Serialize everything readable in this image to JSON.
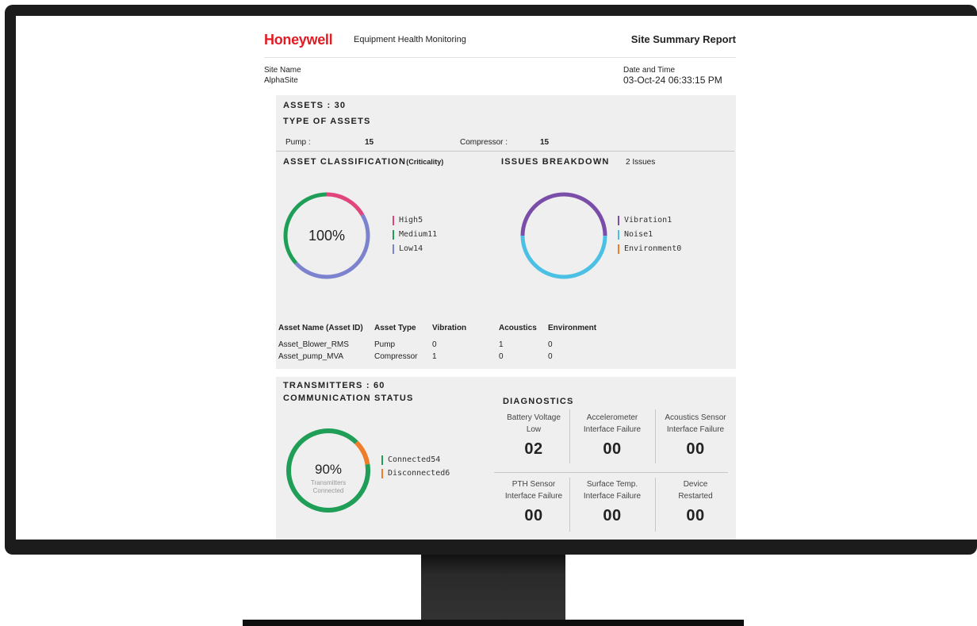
{
  "header": {
    "logo": "Honeywell",
    "app_title": "Equipment Health Monitoring",
    "report_title": "Site Summary Report"
  },
  "site": {
    "name_label": "Site Name",
    "name": "AlphaSite",
    "date_label": "Date and Time",
    "date": "03-Oct-24 06:33:15 PM"
  },
  "assets": {
    "title": "ASSETS : 30",
    "types_title": "TYPE OF ASSETS",
    "types": [
      {
        "label": "Pump :",
        "count": "15"
      },
      {
        "label": "Compressor :",
        "count": "15"
      }
    ],
    "classification_title": "ASSET CLASSIFICATION",
    "classification_sub": "(Criticality)",
    "classification_center": "100%",
    "classification": [
      {
        "name": "High",
        "value": "5",
        "count": 5,
        "color": "#e0457b"
      },
      {
        "name": "Medium",
        "value": "11",
        "count": 11,
        "color": "#1f9e57"
      },
      {
        "name": "Low",
        "value": "14",
        "count": 14,
        "color": "#7b83cf"
      }
    ],
    "issues_title": "ISSUES BREAKDOWN",
    "issues_count": "2 Issues",
    "issues": [
      {
        "name": "Vibration",
        "value": "1",
        "count": 1,
        "color": "#7a4ea8"
      },
      {
        "name": "Noise",
        "value": "1",
        "count": 1,
        "color": "#4bc0e5"
      },
      {
        "name": "Environment",
        "value": "0",
        "count": 0,
        "color": "#ee7d2b"
      }
    ],
    "table": {
      "headers": [
        "Asset Name (Asset ID)",
        "Asset Type",
        "Vibration",
        "Acoustics",
        "Environment"
      ],
      "rows": [
        [
          "Asset_Blower_RMS",
          "Pump",
          "0",
          "1",
          "0"
        ],
        [
          "Asset_pump_MVA",
          "Compressor",
          "1",
          "0",
          "0"
        ]
      ]
    }
  },
  "transmitters": {
    "title": "TRANSMITTERS : 60",
    "comm_title": "COMMUNICATION STATUS",
    "center_value": "90%",
    "center_label_1": "Transmitters",
    "center_label_2": "Connected",
    "status": [
      {
        "name": "Connected",
        "value": "54",
        "count": 54,
        "color": "#1f9e57"
      },
      {
        "name": "Disconnected",
        "value": "6",
        "count": 6,
        "color": "#ee7d2b"
      }
    ]
  },
  "diagnostics": {
    "title": "DIAGNOSTICS",
    "items": [
      {
        "line1": "Battery Voltage",
        "line2": "Low",
        "value": "02"
      },
      {
        "line1": "Accelerometer",
        "line2": "Interface Failure",
        "value": "00"
      },
      {
        "line1": "Acoustics Sensor",
        "line2": "Interface Failure",
        "value": "00"
      },
      {
        "line1": "PTH Sensor",
        "line2": "Interface Failure",
        "value": "00"
      },
      {
        "line1": "Surface Temp.",
        "line2": "Interface Failure",
        "value": "00"
      },
      {
        "line1": "Device",
        "line2": "Restarted",
        "value": "00"
      }
    ]
  }
}
